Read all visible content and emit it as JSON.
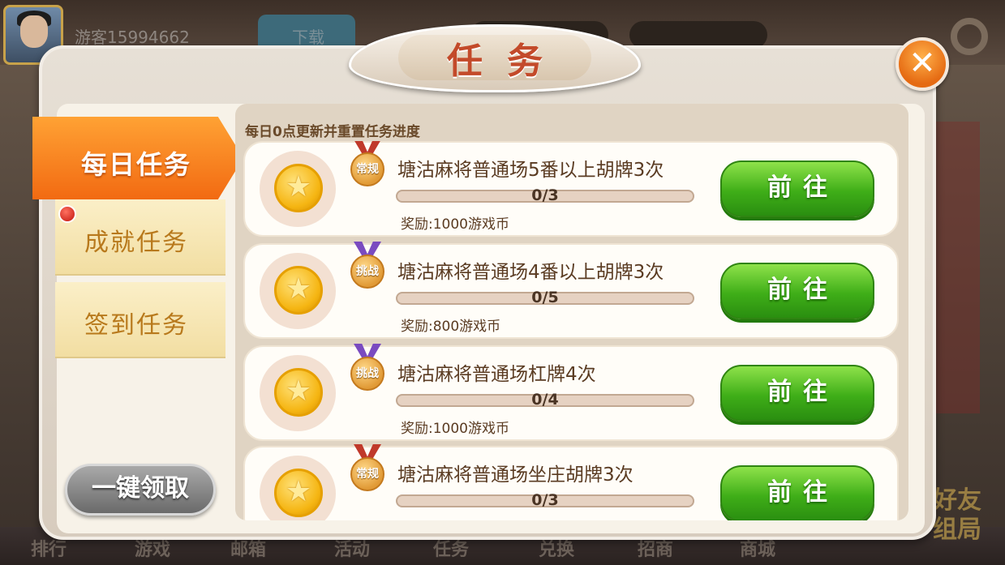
{
  "background": {
    "player_name": "游客15994662",
    "download_label": "下载",
    "bottom_nav": [
      "排行",
      "游戏",
      "邮箱",
      "活动",
      "任务",
      "兑换",
      "招商",
      "商城"
    ],
    "friend_banner": "好友\n组局"
  },
  "dialog": {
    "title": "任务",
    "close_icon": "close-icon",
    "tabs": [
      {
        "label": "每日任务",
        "active": true
      },
      {
        "label": "成就任务",
        "active": false,
        "has_notification": true
      },
      {
        "label": "签到任务",
        "active": false
      }
    ],
    "claim_all_label": "一键领取",
    "note": "每日0点更新并重置任务进度",
    "tasks": [
      {
        "badge": "常规",
        "badge_color": "#c0392b",
        "title": "塘沽麻将普通场5番以上胡牌3次",
        "progress_text": "0/3",
        "progress": 0,
        "reward": "奖励:1000游戏币",
        "button": "前往"
      },
      {
        "badge": "挑战",
        "badge_color": "#7a4bc0",
        "title": "塘沽麻将普通场4番以上胡牌3次",
        "progress_text": "0/5",
        "progress": 0,
        "reward": "奖励:800游戏币",
        "button": "前往"
      },
      {
        "badge": "挑战",
        "badge_color": "#7a4bc0",
        "title": "塘沽麻将普通场杠牌4次",
        "progress_text": "0/4",
        "progress": 0,
        "reward": "奖励:1000游戏币",
        "button": "前往"
      },
      {
        "badge": "常规",
        "badge_color": "#c0392b",
        "title": "塘沽麻将普通场坐庄胡牌3次",
        "progress_text": "0/3",
        "progress": 0,
        "reward": "",
        "button": "前往"
      }
    ]
  },
  "colors": {
    "accent_orange": "#f26a12",
    "go_green": "#3fae18",
    "title_red": "#c34a2a"
  }
}
